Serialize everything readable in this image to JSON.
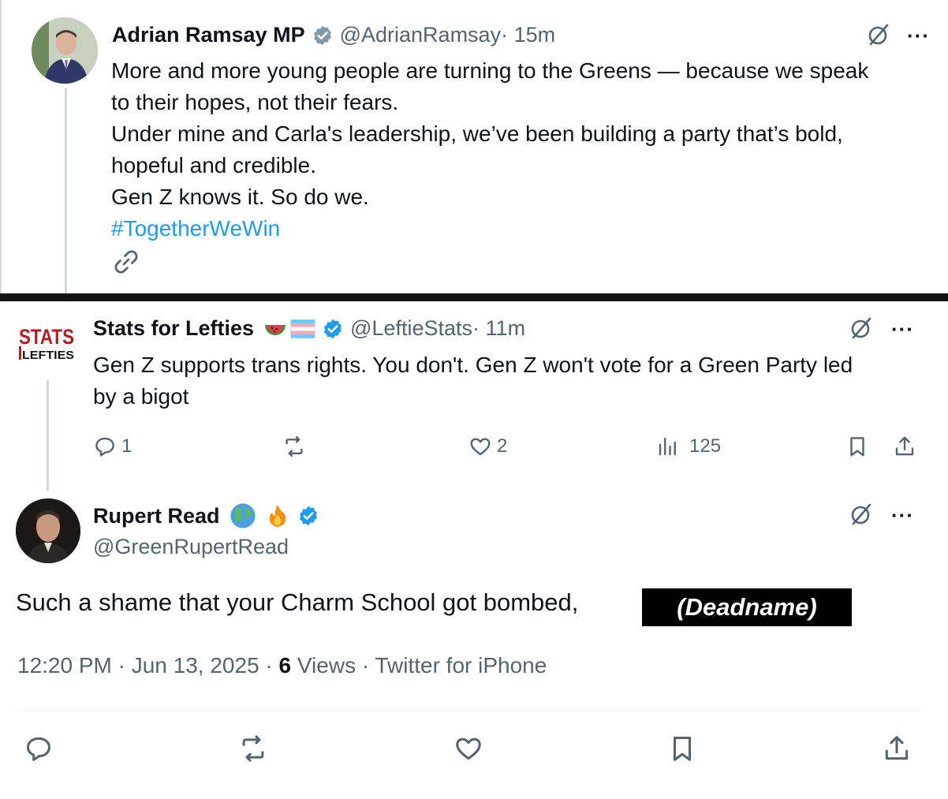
{
  "tweet1": {
    "name": "Adrian Ramsay MP",
    "handle": "@AdrianRamsay",
    "time": " · 15m",
    "lines": [
      "More and more young people are turning to the Greens — because we speak",
      "to their hopes, not their fears.",
      "Under mine and Carla's leadership, we’ve been building a party that’s bold,",
      "hopeful and credible.",
      "Gen Z knows it. So do we."
    ],
    "hashtag": "#TogetherWeWin",
    "more": "···"
  },
  "tweet2": {
    "name": "Stats for Lefties",
    "handle": "@LeftieStats",
    "time": " · 11m",
    "logo_top": "STATS",
    "logo_bottom": "LEFTIES",
    "lines": [
      "Gen Z supports trans rights. You don't. Gen Z won't vote for a Green Party led",
      "by a bigot"
    ],
    "replies": "1",
    "likes": "2",
    "views": "125",
    "more": "···"
  },
  "tweet3": {
    "name": "Rupert Read",
    "handle": "@GreenRupertRead",
    "text": "Such a shame that your Charm School got bombed,",
    "redaction": "(Deadname)",
    "time": "12:20 PM · Jun 13, 2025 · ",
    "views_count": "6",
    "views_label": " Views · Twitter for iPhone",
    "more": "···"
  },
  "colors": {
    "accent": "#1d9bf0",
    "secondary_text": "#536471",
    "verified": "#1d9bf0"
  }
}
